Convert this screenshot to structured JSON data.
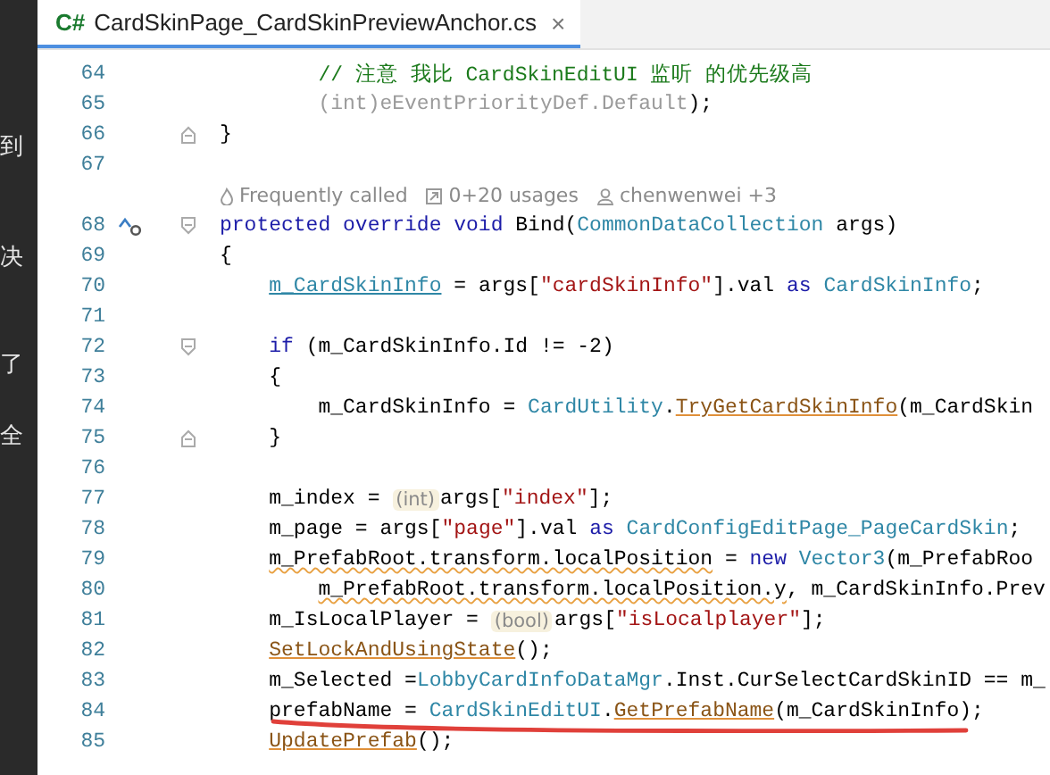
{
  "side_panel": {
    "fragments": [
      "到",
      "决",
      "了",
      "全"
    ]
  },
  "tab": {
    "language": "C#",
    "title": "CardSkinPage_CardSkinPreviewAnchor.cs",
    "close": "×",
    "selected": true
  },
  "lines": [
    {
      "kind": "code",
      "number": "64",
      "tokens": [
        {
          "kind": "comment",
          "text": "        // 注意 我比 CardSkinEditUI 监听 的优先级高"
        }
      ]
    },
    {
      "kind": "code",
      "number": "65",
      "tokens": [
        {
          "kind": "muted",
          "text": "        (int)eEventPriorityDef.Default"
        },
        {
          "kind": "plain",
          "text": ");"
        }
      ]
    },
    {
      "kind": "code",
      "number": "66",
      "fold_end": true,
      "tokens": [
        {
          "kind": "plain",
          "text": "}"
        }
      ]
    },
    {
      "kind": "code",
      "number": "67"
    },
    {
      "kind": "lens",
      "items": [
        {
          "kind": "flame",
          "text": "Frequently called"
        },
        {
          "kind": "usages",
          "text": "0+20 usages"
        },
        {
          "kind": "author",
          "text": "chenwenwei +3"
        }
      ]
    },
    {
      "kind": "code",
      "number": "68",
      "fold_start": true,
      "override": true,
      "tokens": [
        {
          "kind": "keyword",
          "text": "protected override void "
        },
        {
          "kind": "plain",
          "text": "Bind("
        },
        {
          "kind": "type",
          "text": "CommonDataCollection"
        },
        {
          "kind": "plain",
          "text": " args)"
        }
      ]
    },
    {
      "kind": "code",
      "number": "69",
      "tokens": [
        {
          "kind": "plain",
          "text": "{"
        }
      ]
    },
    {
      "kind": "code",
      "number": "70",
      "tokens": [
        {
          "kind": "field",
          "text": "    m_CardSkinInfo"
        },
        {
          "kind": "plain",
          "text": " = args["
        },
        {
          "kind": "string",
          "text": "\"cardSkinInfo\""
        },
        {
          "kind": "plain",
          "text": "].val "
        },
        {
          "kind": "keyword",
          "text": "as "
        },
        {
          "kind": "type",
          "text": "CardSkinInfo"
        },
        {
          "kind": "plain",
          "text": ";"
        }
      ]
    },
    {
      "kind": "code",
      "number": "71"
    },
    {
      "kind": "code",
      "number": "72",
      "fold_start": true,
      "tokens": [
        {
          "kind": "keyword",
          "text": "    if"
        },
        {
          "kind": "plain",
          "text": " (m_CardSkinInfo.Id != -2)"
        }
      ]
    },
    {
      "kind": "code",
      "number": "73",
      "tokens": [
        {
          "kind": "plain",
          "text": "    {"
        }
      ]
    },
    {
      "kind": "code",
      "number": "74",
      "tokens": [
        {
          "kind": "plain",
          "text": "        m_CardSkinInfo = "
        },
        {
          "kind": "type",
          "text": "CardUtility"
        },
        {
          "kind": "plain",
          "text": "."
        },
        {
          "kind": "method",
          "text": "TryGetCardSkinInfo"
        },
        {
          "kind": "plain",
          "text": "(m_CardSkin"
        }
      ]
    },
    {
      "kind": "code",
      "number": "75",
      "fold_end": true,
      "tokens": [
        {
          "kind": "plain",
          "text": "    }"
        }
      ]
    },
    {
      "kind": "code",
      "number": "76"
    },
    {
      "kind": "code",
      "number": "77",
      "tokens": [
        {
          "kind": "plain",
          "text": "    m_index = "
        },
        {
          "kind": "hint",
          "text": "(int)"
        },
        {
          "kind": "plain",
          "text": "args["
        },
        {
          "kind": "string",
          "text": "\"index\""
        },
        {
          "kind": "plain",
          "text": "];"
        }
      ]
    },
    {
      "kind": "code",
      "number": "78",
      "tokens": [
        {
          "kind": "plain",
          "text": "    m_page = args["
        },
        {
          "kind": "string",
          "text": "\"page\""
        },
        {
          "kind": "plain",
          "text": "].val "
        },
        {
          "kind": "keyword",
          "text": "as "
        },
        {
          "kind": "type",
          "text": "CardConfigEditPage_PageCardSkin"
        },
        {
          "kind": "plain",
          "text": ";"
        }
      ]
    },
    {
      "kind": "code",
      "number": "79",
      "tokens": [
        {
          "kind": "warning",
          "text": "    m_PrefabRoot.transform.localPosition"
        },
        {
          "kind": "plain",
          "text": " = "
        },
        {
          "kind": "keyword",
          "text": "new "
        },
        {
          "kind": "type",
          "text": "Vector3"
        },
        {
          "kind": "plain",
          "text": "(m_PrefabRoo"
        }
      ]
    },
    {
      "kind": "code",
      "number": "80",
      "tokens": [
        {
          "kind": "warning",
          "text": "        m_PrefabRoot.transform.localPosition.y"
        },
        {
          "kind": "plain",
          "text": ", m_CardSkinInfo.Prev"
        }
      ]
    },
    {
      "kind": "code",
      "number": "81",
      "tokens": [
        {
          "kind": "plain",
          "text": "    m_IsLocalPlayer = "
        },
        {
          "kind": "hint",
          "text": "(bool)"
        },
        {
          "kind": "plain",
          "text": "args["
        },
        {
          "kind": "string",
          "text": "\"isLocalplayer\""
        },
        {
          "kind": "plain",
          "text": "];"
        }
      ]
    },
    {
      "kind": "code",
      "number": "82",
      "tokens": [
        {
          "kind": "method",
          "text": "    SetLockAndUsingState"
        },
        {
          "kind": "plain",
          "text": "();"
        }
      ]
    },
    {
      "kind": "code",
      "number": "83",
      "tokens": [
        {
          "kind": "plain",
          "text": "    m_Selected ="
        },
        {
          "kind": "type",
          "text": "LobbyCardInfoDataMgr"
        },
        {
          "kind": "plain",
          "text": ".Inst.CurSelectCardSkinID == m_"
        }
      ]
    },
    {
      "kind": "code",
      "number": "84",
      "annotated": true,
      "tokens": [
        {
          "kind": "plain",
          "text": "    prefabName = "
        },
        {
          "kind": "type",
          "text": "CardSkinEditUI"
        },
        {
          "kind": "plain",
          "text": "."
        },
        {
          "kind": "method",
          "text": "GetPrefabName"
        },
        {
          "kind": "plain",
          "text": "(m_CardSkinInfo);"
        }
      ]
    },
    {
      "kind": "code",
      "number": "85",
      "tokens": [
        {
          "kind": "method",
          "text": "    UpdatePrefab"
        },
        {
          "kind": "plain",
          "text": "();"
        }
      ]
    }
  ]
}
